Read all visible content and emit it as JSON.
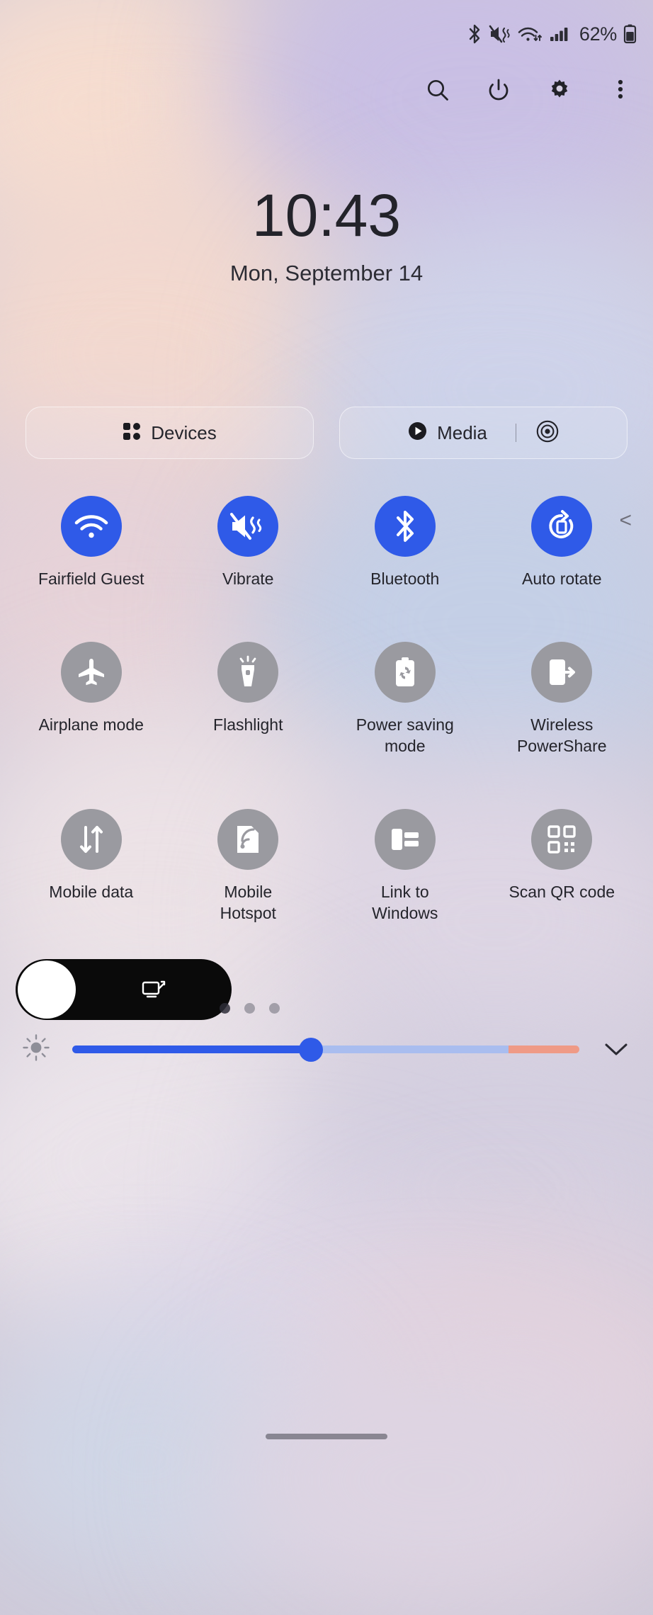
{
  "statusbar": {
    "battery_percent": "62%",
    "icons": [
      "bluetooth-icon",
      "vibrate-mute-icon",
      "wifi-data-icon",
      "signal-bars-icon",
      "battery-icon"
    ]
  },
  "header": {
    "actions": [
      {
        "name": "search-icon",
        "label": "Search"
      },
      {
        "name": "power-icon",
        "label": "Power"
      },
      {
        "name": "gear-icon",
        "label": "Settings"
      },
      {
        "name": "overflow-menu-icon",
        "label": "More options"
      }
    ]
  },
  "clock": {
    "time": "10:43",
    "date": "Mon, September 14"
  },
  "pills": {
    "devices": {
      "label": "Devices",
      "icon": "grid-dots-icon"
    },
    "media": {
      "label": "Media",
      "icon": "play-circle-icon",
      "output_icon": "output-target-icon"
    }
  },
  "toggles": {
    "rows": [
      {
        "chevron": "<",
        "tiles": [
          {
            "label": "Fairfield Guest",
            "icon": "wifi-icon",
            "active": true
          },
          {
            "label": "Vibrate",
            "icon": "vibrate-icon",
            "active": true
          },
          {
            "label": "Bluetooth",
            "icon": "bluetooth-icon",
            "active": true
          },
          {
            "label": "Auto rotate",
            "icon": "auto-rotate-icon",
            "active": true
          }
        ]
      },
      {
        "tiles": [
          {
            "label": "Airplane mode",
            "icon": "airplane-icon",
            "active": false
          },
          {
            "label": "Flashlight",
            "icon": "flashlight-icon",
            "active": false
          },
          {
            "label": "Power saving mode",
            "icon": "power-saving-icon",
            "active": false
          },
          {
            "label": "Wireless PowerShare",
            "icon": "wireless-powershare-icon",
            "active": false
          }
        ]
      },
      {
        "tiles": [
          {
            "label": "Mobile data",
            "icon": "mobile-data-icon",
            "active": false
          },
          {
            "label": "Mobile Hotspot",
            "icon": "hotspot-icon",
            "active": false
          },
          {
            "label": "Link to Windows",
            "icon": "link-to-windows-icon",
            "active": false
          },
          {
            "label": "Scan QR code",
            "icon": "qr-code-icon",
            "active": false
          }
        ]
      }
    ]
  },
  "bottom": {
    "pill_icon": "screen-capture-icon",
    "page_dots": 3,
    "active_dot": 0
  },
  "brightness": {
    "icon": "brightness-sun-icon",
    "value_percent": 47,
    "expand_icon": "chevron-down-icon"
  },
  "colors": {
    "accent_blue": "#2f5ae8",
    "tile_off": "#9a9aa0",
    "text_dark": "#24242b",
    "slider_tail": "#ef9a86"
  }
}
